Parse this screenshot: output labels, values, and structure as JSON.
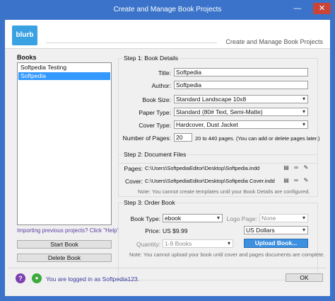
{
  "window": {
    "title": "Create and Manage Book Projects",
    "minimize_glyph": "—",
    "close_glyph": "✕"
  },
  "header": {
    "logo_text": "blurb",
    "title": "Create and Manage Book Projects"
  },
  "books": {
    "label": "Books",
    "items": [
      {
        "label": "Softpedia Testing",
        "selected": false
      },
      {
        "label": "Softpedia",
        "selected": true
      }
    ],
    "import_link": "Importing previous projects? Click \"Help\"",
    "start_button": "Start Book",
    "delete_button": "Delete Book"
  },
  "step1": {
    "title": "Step 1: Book Details",
    "title_label": "Title:",
    "title_value": "Softpedia",
    "author_label": "Author:",
    "author_value": "Softpedia",
    "book_size_label": "Book Size:",
    "book_size_value": "Standard Landscape 10x8",
    "paper_type_label": "Paper Type:",
    "paper_type_value": "Standard (80# Text, Semi-Matte)",
    "cover_type_label": "Cover Type:",
    "cover_type_value": "Hardcover, Dust Jacket",
    "pages_label": "Number of Pages:",
    "pages_value": "20",
    "pages_note": "20 to 440 pages. (You can add or delete pages later.)"
  },
  "step2": {
    "title": "Step 2: Document Files",
    "pages_label": "Pages:",
    "pages_path": "C:\\Users\\SoftpediaEditor\\Desktop\\Softpedia.indd",
    "cover_label": "Cover:",
    "cover_path": "C:\\Users\\SoftpediaEditor\\Desktop\\Softpedia Cover.indd",
    "note": "Note: You cannot create templates until your Book Details are configured."
  },
  "step3": {
    "title": "Step 3: Order Book",
    "book_type_label": "Book Type:",
    "book_type_value": "ebook",
    "logo_page_label": "Logo Page:",
    "logo_page_value": "None",
    "price_label": "Price:",
    "price_value": "US $9.99",
    "currency_value": "US Dollars",
    "quantity_label": "Quantity:",
    "quantity_value": "1-9 Books",
    "upload_button": "Upload Book...",
    "note": "Note: You cannot upload your book until cover and pages documents are complete."
  },
  "footer": {
    "help_glyph": "?",
    "user_glyph": "●",
    "logged_in_text": "You are logged in as Softpedia123.",
    "ok_button": "OK"
  },
  "icons": {
    "file_icon": "▤",
    "link_icon": "∞",
    "edit_icon": "✎"
  },
  "colors": {
    "window_frame": "#3a73c9",
    "selection": "#3399ff",
    "upload_button": "#3d8fe0",
    "link_text": "#5a3ea1"
  }
}
